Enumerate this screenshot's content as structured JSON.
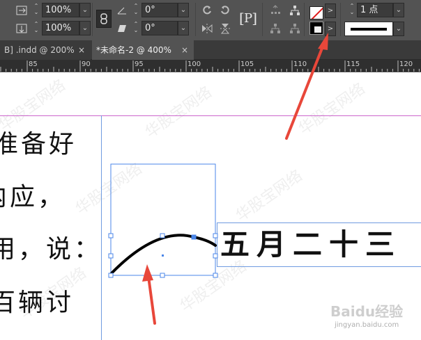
{
  "control_panel": {
    "row1": {
      "scale_x": "100%",
      "rotate": "0°"
    },
    "row2": {
      "scale_y": "100%",
      "shear": "0°"
    },
    "stroke_weight": "1 点",
    "chevron": ">",
    "dropdown_arrow": "⌄"
  },
  "tabs": [
    {
      "label": "B] .indd @ 200%",
      "close": "×",
      "active": false
    },
    {
      "label": "*未命名-2 @ 400%",
      "close": "×",
      "active": true
    }
  ],
  "ruler": {
    "labels": [
      "85",
      "90",
      "95",
      "100",
      "105",
      "110",
      "115",
      "120"
    ]
  },
  "canvas": {
    "vertical_text_lines": [
      "准备好",
      "内应，",
      "用，说：",
      "百辆讨"
    ],
    "frame_text": "五月二十三",
    "watermark_text": "华股宝网络"
  },
  "watermark": {
    "logo": "Baidu经验",
    "url": "jingyan.baidu.com"
  },
  "colors": {
    "accent_arrow": "#e8473a",
    "selection": "#4a86e8",
    "guide_magenta": "#cc66cc",
    "guide_blue": "#6f9be0"
  }
}
